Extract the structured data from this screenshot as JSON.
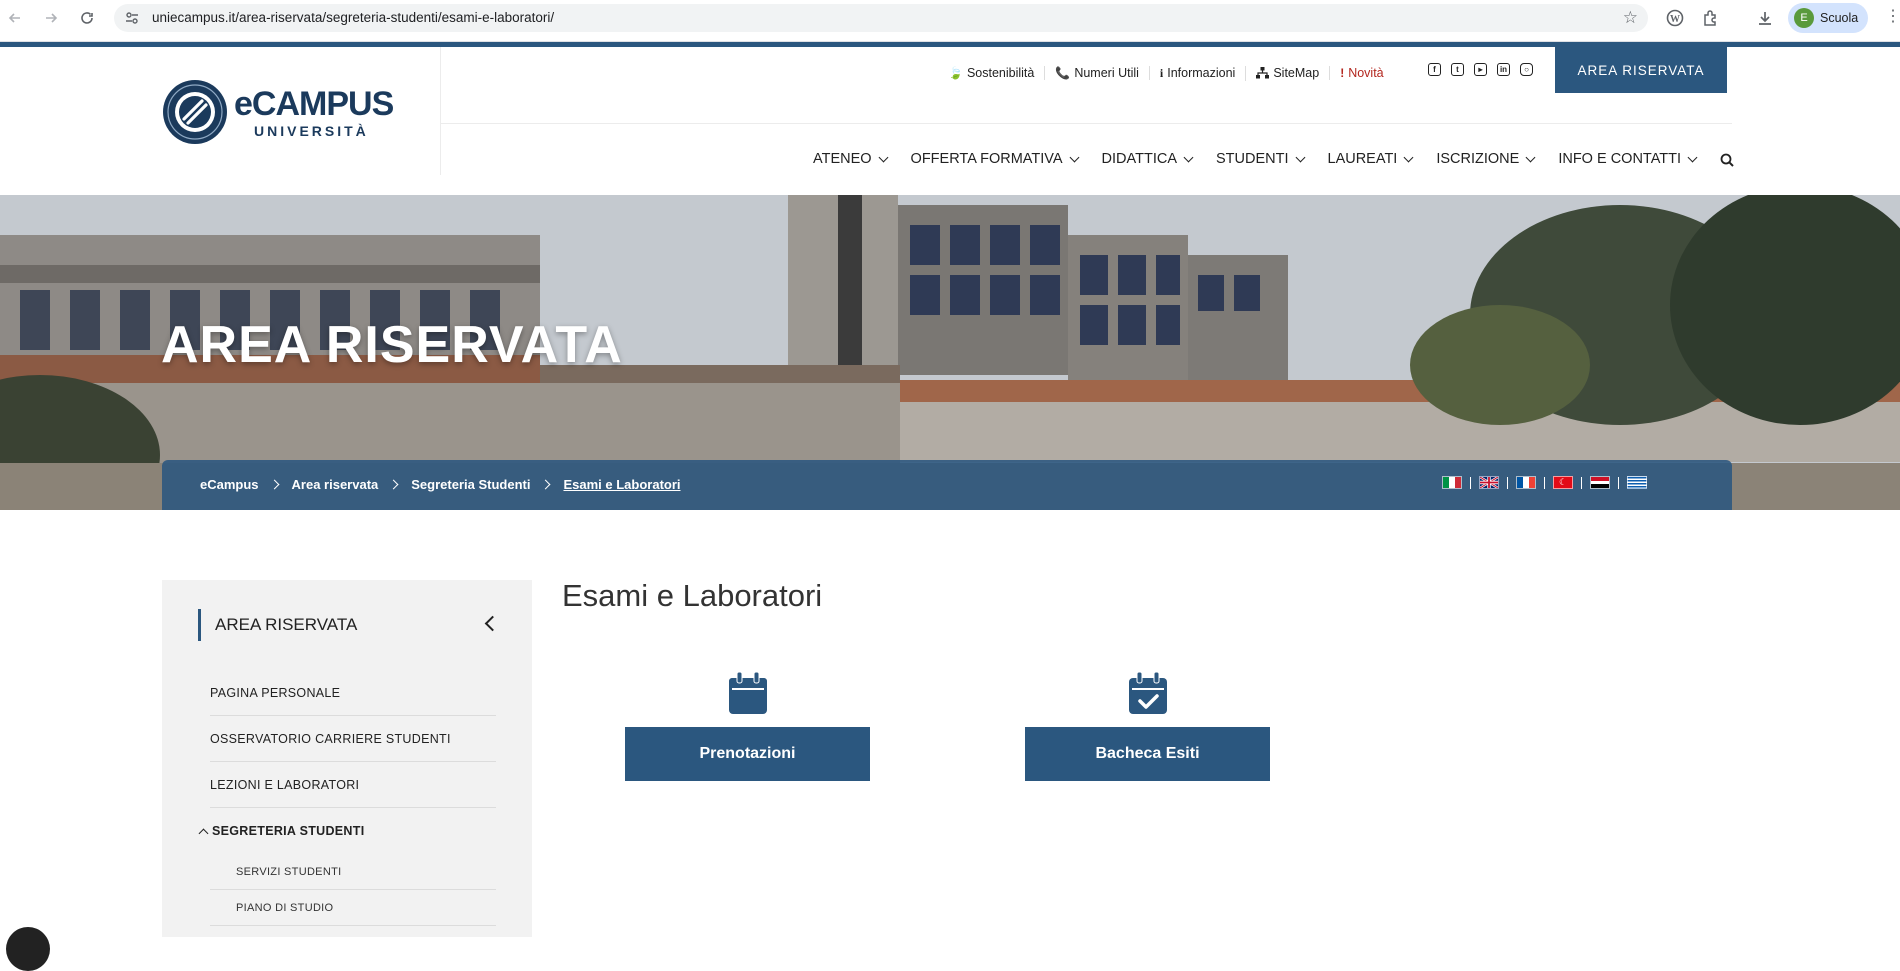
{
  "browser": {
    "url": "uniecampus.it/area-riservata/segreteria-studenti/esami-e-laboratori/",
    "profile_initial": "E",
    "profile_name": "Scuola"
  },
  "header": {
    "logo_main": "eCAMPUS",
    "logo_sub": "UNIVERSITÀ",
    "utility_links": [
      {
        "label": "Sostenibilità",
        "icon": "leaf-icon"
      },
      {
        "label": "Numeri Utili",
        "icon": "phone-icon"
      },
      {
        "label": "Informazioni",
        "icon": "info-icon"
      },
      {
        "label": "SiteMap",
        "icon": "sitemap-icon"
      },
      {
        "label": "Novità",
        "icon": "exclamation-icon"
      }
    ],
    "social": [
      "facebook-icon",
      "twitter-icon",
      "youtube-icon",
      "linkedin-icon",
      "instagram-icon"
    ],
    "area_button": "AREA RISERVATA",
    "nav": [
      "ATENEO",
      "OFFERTA FORMATIVA",
      "DIDATTICA",
      "STUDENTI",
      "LAUREATI",
      "ISCRIZIONE",
      "INFO E CONTATTI"
    ]
  },
  "hero": {
    "title": "AREA RISERVATA",
    "breadcrumb": [
      "eCampus",
      "Area riservata",
      "Segreteria Studenti",
      "Esami e Laboratori"
    ],
    "flags": [
      "italian-flag-icon",
      "uk-flag-icon",
      "french-flag-icon",
      "turkish-flag-icon",
      "egyptian-flag-icon",
      "greek-flag-icon"
    ]
  },
  "sidebar": {
    "title": "AREA RISERVATA",
    "items": [
      "PAGINA PERSONALE",
      "OSSERVATORIO CARRIERE STUDENTI",
      "LEZIONI E LABORATORI"
    ],
    "expanded_item": "SEGRETERIA STUDENTI",
    "sub_items": [
      "SERVIZI STUDENTI",
      "PIANO DI STUDIO"
    ]
  },
  "content": {
    "title": "Esami e Laboratori",
    "cards": [
      {
        "label": "Prenotazioni",
        "icon": "calendar-icon"
      },
      {
        "label": "Bacheca Esiti",
        "icon": "calendar-check-icon"
      }
    ]
  },
  "colors": {
    "brand_blue": "#2b577f",
    "logo_navy": "#1b3a5c",
    "novita_red": "#b3261e"
  }
}
